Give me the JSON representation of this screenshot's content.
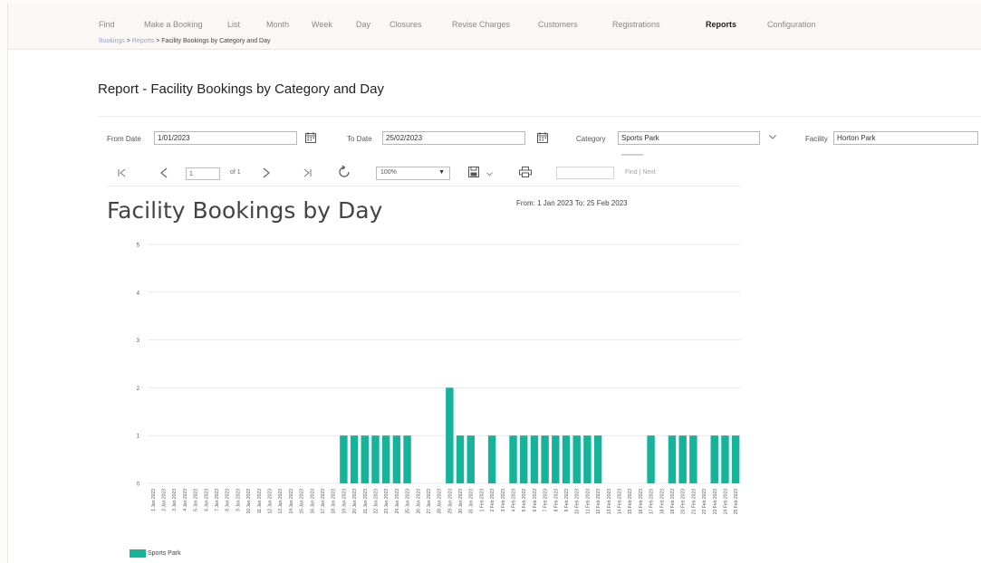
{
  "nav": {
    "items": [
      {
        "label": "Find",
        "active": false
      },
      {
        "label": "Make a Booking",
        "active": false
      },
      {
        "label": "List",
        "active": false
      },
      {
        "label": "Month",
        "active": false
      },
      {
        "label": "Week",
        "active": false
      },
      {
        "label": "Day",
        "active": false
      },
      {
        "label": "Closures",
        "active": false
      },
      {
        "label": "Revise Charges",
        "active": false
      },
      {
        "label": "Customers",
        "active": false
      },
      {
        "label": "Registrations",
        "active": false
      },
      {
        "label": "Reports",
        "active": true
      },
      {
        "label": "Configuration",
        "active": false
      }
    ]
  },
  "breadcrumb": {
    "bookings": "Bookings",
    "sep1": " > ",
    "reports": "Reports",
    "sep2": " > ",
    "current": "Facility Bookings by Category and Day"
  },
  "page": {
    "title": "Report - Facility Bookings by Category and Day"
  },
  "filters": {
    "from_label": "From Date",
    "from_value": "1/01/2023",
    "to_label": "To Date",
    "to_value": "25/02/2023",
    "category_label": "Category",
    "category_value": "Sports Park",
    "facility_label": "Facility",
    "facility_value": "Horton Park"
  },
  "viewer": {
    "page_value": "1",
    "of_label": "of 1",
    "zoom_value": "100%",
    "find_label": "Find",
    "find_sep": " | ",
    "next_label": "Next",
    "icons": [
      "first-page-icon",
      "prev-page-icon",
      "next-page-icon",
      "last-page-icon",
      "refresh-icon",
      "save-icon",
      "print-icon"
    ]
  },
  "report": {
    "title": "Facility Bookings by Day",
    "range": "From: 1 Jan 2023    To: 25 Feb 2023"
  },
  "colors": {
    "series": "#14b39a",
    "gridline": "#e9e9e9"
  },
  "chart_data": {
    "type": "bar",
    "title": "Facility Bookings by Day",
    "xlabel": "",
    "ylabel": "",
    "ylim": [
      0,
      3
    ],
    "yticks": [
      "0",
      "1",
      "2",
      "3",
      "4",
      "5"
    ],
    "grid": true,
    "legend_position": "bottom-left",
    "categories": [
      "1 Jan 2023",
      "2 Jan 2023",
      "3 Jan 2023",
      "4 Jan 2023",
      "5 Jan 2023",
      "6 Jan 2023",
      "7 Jan 2023",
      "8 Jan 2023",
      "9 Jan 2023",
      "10 Jan 2023",
      "11 Jan 2023",
      "12 Jan 2023",
      "13 Jan 2023",
      "14 Jan 2023",
      "15 Jan 2023",
      "16 Jan 2023",
      "17 Jan 2023",
      "18 Jan 2023",
      "19 Jan 2023",
      "20 Jan 2023",
      "21 Jan 2023",
      "22 Jan 2023",
      "23 Jan 2023",
      "24 Jan 2023",
      "25 Jan 2023",
      "26 Jan 2023",
      "27 Jan 2023",
      "28 Jan 2023",
      "29 Jan 2023",
      "30 Jan 2023",
      "31 Jan 2023",
      "1 Feb 2023",
      "2 Feb 2023",
      "3 Feb 2023",
      "4 Feb 2023",
      "5 Feb 2023",
      "6 Feb 2023",
      "7 Feb 2023",
      "8 Feb 2023",
      "9 Feb 2023",
      "10 Feb 2023",
      "11 Feb 2023",
      "12 Feb 2023",
      "13 Feb 2023",
      "14 Feb 2023",
      "15 Feb 2023",
      "16 Feb 2023",
      "17 Feb 2023",
      "18 Feb 2023",
      "19 Feb 2023",
      "20 Feb 2023",
      "21 Feb 2023",
      "22 Feb 2023",
      "23 Feb 2023",
      "24 Feb 2023",
      "25 Feb 2023"
    ],
    "series": [
      {
        "name": "Sports Park",
        "values": [
          0,
          0,
          0,
          0,
          0,
          0,
          0,
          0,
          0,
          0,
          0,
          0,
          0,
          0,
          0,
          0,
          0,
          0,
          1,
          1,
          1,
          1,
          1,
          1,
          1,
          0,
          0,
          0,
          2,
          1,
          1,
          0,
          1,
          0,
          1,
          1,
          1,
          1,
          1,
          1,
          1,
          1,
          1,
          0,
          0,
          0,
          0,
          1,
          0,
          1,
          1,
          1,
          0,
          1,
          1,
          1
        ]
      }
    ]
  }
}
